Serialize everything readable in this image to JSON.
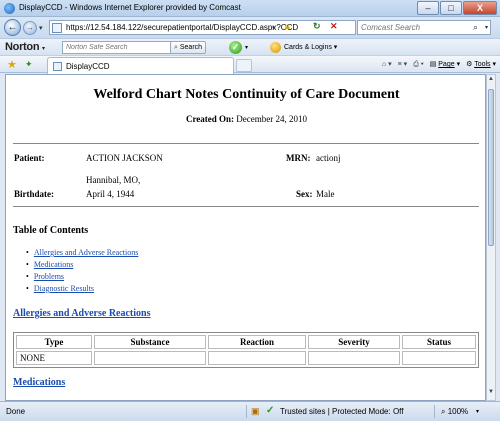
{
  "window": {
    "title": "DisplayCCD - Windows Internet Explorer provided by Comcast",
    "minimize": "–",
    "maximize": "□",
    "close": "X"
  },
  "address": {
    "url": "https://12.54.184.122/securepatientportal/DisplayCCD.aspx?CCD",
    "search_placeholder": "Comcast Search"
  },
  "norton": {
    "logo": "Norton",
    "search_placeholder": "Norton Safe Search",
    "search_button": "Search",
    "cards_label": "Cards & Logins"
  },
  "tabs": [
    {
      "label": "DisplayCCD"
    }
  ],
  "command_bar": {
    "page": "Page",
    "tools": "Tools"
  },
  "document": {
    "title": "Welford Chart Notes Continuity of Care Document",
    "created_label": "Created On:",
    "created_value": "December 24, 2010",
    "patient_label": "Patient:",
    "patient_name": "ACTION JACKSON",
    "mrn_label": "MRN:",
    "mrn_value": "actionj",
    "address": "Hannibal, MO,",
    "birthdate_label": "Birthdate:",
    "birthdate_value": "April 4, 1944",
    "sex_label": "Sex:",
    "sex_value": "Male",
    "toc_title": "Table of Contents",
    "toc": [
      "Allergies and Adverse Reactions",
      "Medications",
      "Problems",
      "Diagnostic Results"
    ],
    "allergies_heading": "Allergies and Adverse Reactions",
    "allergies_table": {
      "columns": [
        "Type",
        "Substance",
        "Reaction",
        "Severity",
        "Status"
      ],
      "rows": [
        [
          "NONE",
          "",
          "",
          "",
          ""
        ]
      ]
    },
    "medications_heading": "Medications"
  },
  "status": {
    "text": "Done",
    "zone": "Trusted sites | Protected Mode: Off",
    "zoom": "100%"
  }
}
